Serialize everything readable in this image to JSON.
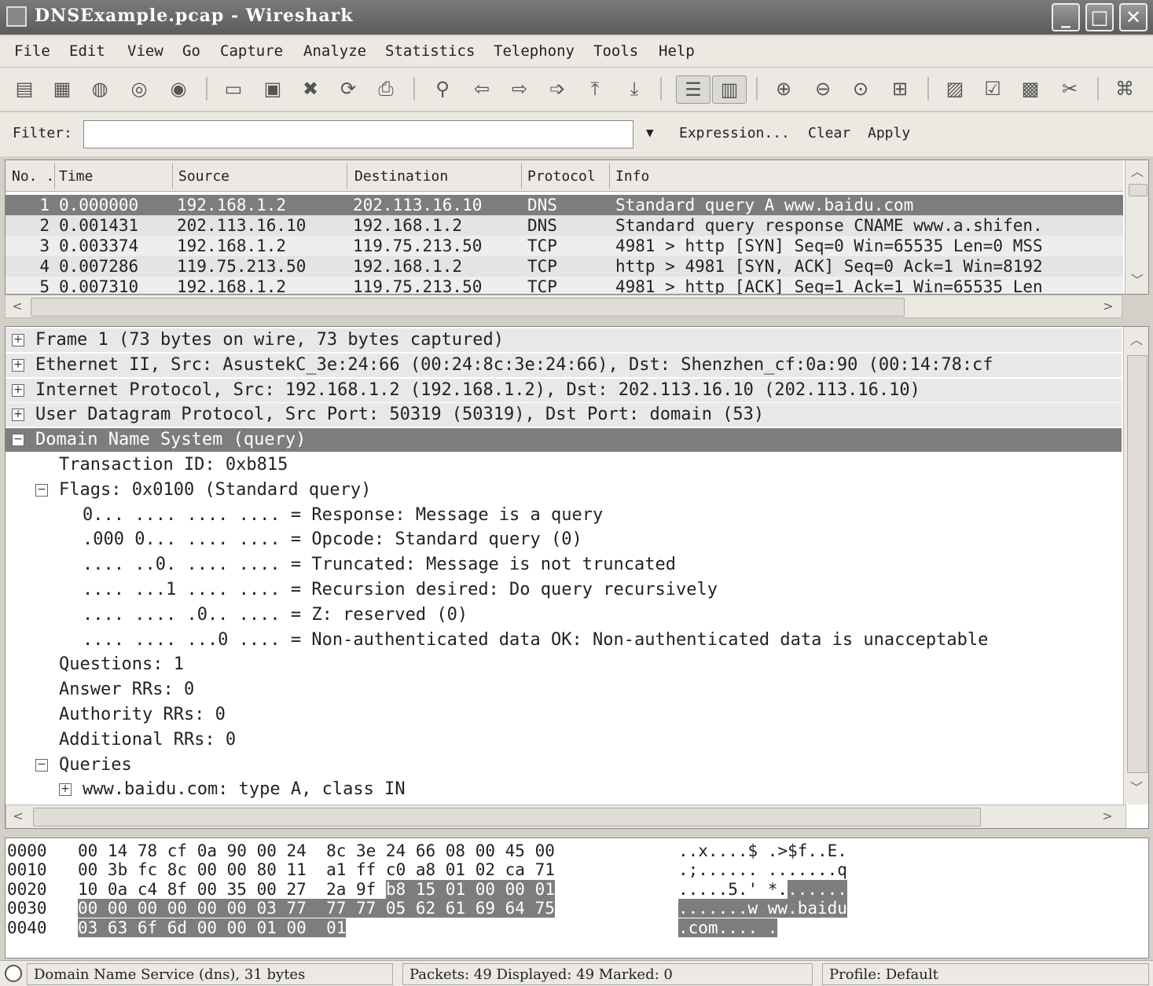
{
  "window": {
    "title": "DNSExample.pcap - Wireshark",
    "minimize": "_",
    "maximize": "□",
    "close": "✕"
  },
  "menu": [
    "File",
    "Edit",
    "View",
    "Go",
    "Capture",
    "Analyze",
    "Statistics",
    "Telephony",
    "Tools",
    "Help"
  ],
  "filter": {
    "label": "Filter:",
    "value": "",
    "expression_label": "Expression...",
    "clear_label": "Clear",
    "apply_label": "Apply"
  },
  "packet_list": {
    "columns": [
      "No. .",
      "Time",
      "Source",
      "Destination",
      "Protocol",
      "Info"
    ],
    "rows": [
      {
        "no": "1",
        "time": "0.000000",
        "source": "192.168.1.2",
        "destination": "202.113.16.10",
        "protocol": "DNS",
        "info": "Standard query A www.baidu.com"
      },
      {
        "no": "2",
        "time": "0.001431",
        "source": "202.113.16.10",
        "destination": "192.168.1.2",
        "protocol": "DNS",
        "info": "Standard query response CNAME www.a.shifen."
      },
      {
        "no": "3",
        "time": "0.003374",
        "source": "192.168.1.2",
        "destination": "119.75.213.50",
        "protocol": "TCP",
        "info": "4981 > http [SYN] Seq=0 Win=65535 Len=0 MSS"
      },
      {
        "no": "4",
        "time": "0.007286",
        "source": "119.75.213.50",
        "destination": "192.168.1.2",
        "protocol": "TCP",
        "info": "http > 4981 [SYN, ACK] Seq=0 Ack=1 Win=8192"
      },
      {
        "no": "5",
        "time": "0.007310",
        "source": "192.168.1.2",
        "destination": "119.75.213.50",
        "protocol": "TCP",
        "info": "4981 > http [ACK] Seq=1 Ack=1 Win=65535 Len"
      }
    ]
  },
  "details": [
    {
      "text": "Frame 1 (73 bytes on wire, 73 bytes captured)",
      "expander": "+"
    },
    {
      "text": "Ethernet II, Src: AsustekC_3e:24:66 (00:24:8c:3e:24:66), Dst: Shenzhen_cf:0a:90 (00:14:78:cf",
      "expander": "+"
    },
    {
      "text": "Internet Protocol, Src: 192.168.1.2 (192.168.1.2), Dst: 202.113.16.10 (202.113.16.10)",
      "expander": "+"
    },
    {
      "text": "User Datagram Protocol, Src Port: 50319 (50319), Dst Port: domain (53)",
      "expander": "+"
    },
    {
      "text": "Domain Name System (query)",
      "expander": "−"
    },
    {
      "text": "Transaction ID: 0xb815",
      "expander": ""
    },
    {
      "text": "Flags: 0x0100 (Standard query)",
      "expander": "−"
    },
    {
      "text": "0... .... .... .... = Response: Message is a query",
      "expander": ""
    },
    {
      "text": ".000 0... .... .... = Opcode: Standard query (0)",
      "expander": ""
    },
    {
      "text": ".... ..0. .... .... = Truncated: Message is not truncated",
      "expander": ""
    },
    {
      "text": ".... ...1 .... .... = Recursion desired: Do query recursively",
      "expander": ""
    },
    {
      "text": ".... .... .0.. .... = Z: reserved (0)",
      "expander": ""
    },
    {
      "text": ".... .... ...0 .... = Non-authenticated data OK: Non-authenticated data is unacceptable",
      "expander": ""
    },
    {
      "text": "Questions: 1",
      "expander": ""
    },
    {
      "text": "Answer RRs: 0",
      "expander": ""
    },
    {
      "text": "Authority RRs: 0",
      "expander": ""
    },
    {
      "text": "Additional RRs: 0",
      "expander": ""
    },
    {
      "text": "Queries",
      "expander": "−"
    },
    {
      "text": "www.baidu.com: type A, class IN",
      "expander": "+"
    }
  ],
  "hex": [
    {
      "offset": "0000",
      "bytes": "00 14 78 cf 0a 90 00 24  8c 3e 24 66 08 00 45 00",
      "bytes_hl": "",
      "ascii": "..x....$ .>$f..E.",
      "ascii_hl": ""
    },
    {
      "offset": "0010",
      "bytes": "00 3b fc 8c 00 00 80 11  a1 ff c0 a8 01 02 ca 71",
      "bytes_hl": "",
      "ascii": ".;...... .......q",
      "ascii_hl": ""
    },
    {
      "offset": "0020",
      "bytes": "10 0a c4 8f 00 35 00 27  2a 9f ",
      "bytes_hl": "b8 15 01 00 00 01",
      "ascii": ".....5.' *.",
      "ascii_hl": "......"
    },
    {
      "offset": "0030",
      "bytes": "",
      "bytes_hl": "00 00 00 00 00 00 03 77  77 77 05 62 61 69 64 75",
      "ascii": "",
      "ascii_hl": ".......w ww.baidu"
    },
    {
      "offset": "0040",
      "bytes": "",
      "bytes_hl": "03 63 6f 6d 00 00 01 00  01",
      "ascii": "",
      "ascii_hl": ".com.... ."
    }
  ],
  "status": {
    "field": "Domain Name Service (dns), 31 bytes",
    "packets": "Packets: 49 Displayed: 49 Marked: 0",
    "profile": "Profile: Default"
  }
}
